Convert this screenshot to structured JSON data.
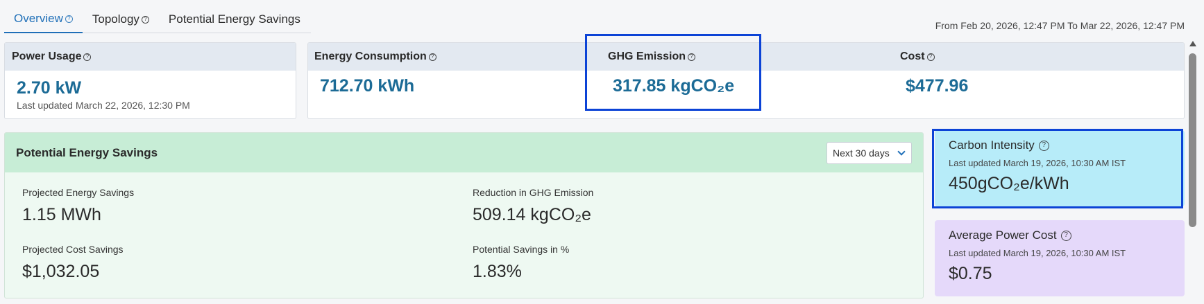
{
  "tabs": [
    {
      "label": "Overview",
      "has_help": true,
      "active": true
    },
    {
      "label": "Topology",
      "has_help": true,
      "active": false
    },
    {
      "label": "Potential Energy Savings",
      "has_help": false,
      "active": false
    }
  ],
  "date_range": "From Feb 20, 2026, 12:47 PM To Mar 22, 2026, 12:47 PM",
  "power_usage": {
    "title": "Power Usage",
    "value": "2.70 kW",
    "last_updated": "Last updated March 22, 2026, 12:30 PM"
  },
  "energy_summary": {
    "energy_consumption": {
      "title": "Energy Consumption",
      "value": "712.70 kWh"
    },
    "ghg_emission": {
      "title": "GHG Emission",
      "value": "317.85 kgCO₂e"
    },
    "cost": {
      "title": "Cost",
      "value": "$477.96"
    }
  },
  "potential_savings": {
    "title": "Potential Energy Savings",
    "period": "Next 30 days",
    "projected_energy_savings": {
      "label": "Projected Energy Savings",
      "value": "1.15 MWh"
    },
    "reduction_ghg": {
      "label": "Reduction in GHG Emission",
      "value": "509.14 kgCO₂e"
    },
    "projected_cost_savings": {
      "label": "Projected Cost Savings",
      "value": "$1,032.05"
    },
    "potential_savings_pct": {
      "label": "Potential Savings in %",
      "value": "1.83%"
    }
  },
  "carbon_intensity": {
    "title": "Carbon Intensity",
    "last_updated": "Last updated March 19, 2026, 10:30 AM IST",
    "value": "450gCO₂e/kWh"
  },
  "average_power_cost": {
    "title": "Average Power Cost",
    "last_updated": "Last updated March 19, 2026, 10:30 AM IST",
    "value": "$0.75"
  },
  "colors": {
    "accent": "#1f6fb8",
    "metric_value": "#1c6b96",
    "highlight_border": "#0c43d6",
    "savings_header_bg": "#c7edd6",
    "carbon_card_bg": "#b7ecf9",
    "power_cost_card_bg": "#e5d9fa"
  },
  "icons": {
    "help": "question-circle-icon",
    "dropdown": "chevron-down-icon"
  }
}
